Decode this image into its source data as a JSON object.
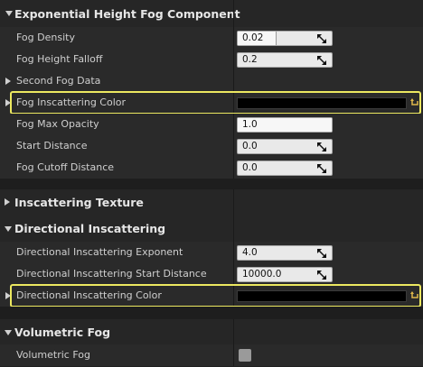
{
  "sections": {
    "fog": {
      "title": "Exponential Height Fog Component"
    },
    "inscattering_texture": {
      "title": "Inscattering Texture"
    },
    "directional": {
      "title": "Directional Inscattering"
    },
    "volumetric": {
      "title": "Volumetric Fog"
    }
  },
  "fog_rows": {
    "density": {
      "label": "Fog Density",
      "value": "0.02",
      "slider_fraction": 0.4
    },
    "falloff": {
      "label": "Fog Height Falloff",
      "value": "0.2"
    },
    "second": {
      "label": "Second Fog Data"
    },
    "inscatter_color": {
      "label": "Fog Inscattering Color",
      "color": "#000000"
    },
    "max_opacity": {
      "label": "Fog Max Opacity",
      "value": "1.0",
      "slider_fraction": 1.0
    },
    "start_distance": {
      "label": "Start Distance",
      "value": "0.0"
    },
    "cutoff_distance": {
      "label": "Fog Cutoff Distance",
      "value": "0.0"
    }
  },
  "directional_rows": {
    "exponent": {
      "label": "Directional Inscattering Exponent",
      "value": "4.0"
    },
    "start_distance": {
      "label": "Directional Inscattering Start Distance",
      "value": "10000.0"
    },
    "color": {
      "label": "Directional Inscattering Color",
      "color": "#000000"
    }
  },
  "volumetric_rows": {
    "enabled": {
      "label": "Volumetric Fog",
      "checked": false
    }
  },
  "colors": {
    "highlight": "#ece860",
    "background": "#1f1f1f",
    "row": "#2a2a2a"
  }
}
